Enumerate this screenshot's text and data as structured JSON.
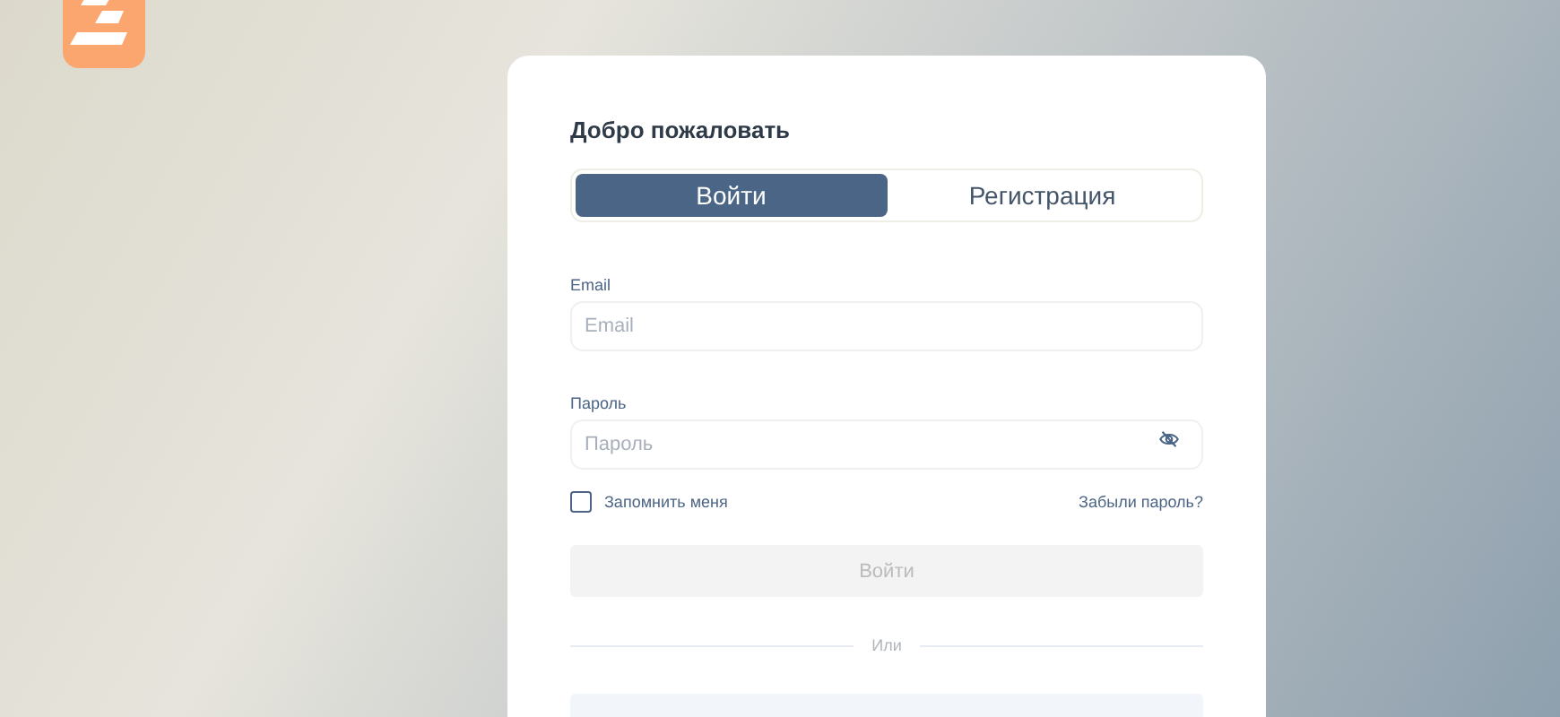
{
  "title": "Добро пожаловать",
  "tabs": [
    {
      "label": "Войти",
      "selected": true
    },
    {
      "label": "Регистрация",
      "selected": false
    }
  ],
  "email": {
    "label": "Email",
    "placeholder": "Email"
  },
  "password": {
    "label": "Пароль",
    "placeholder": "Пароль"
  },
  "remember": {
    "label": "Запомнить меня",
    "checked": false
  },
  "forgot": "Забыли пароль?",
  "submit": {
    "label": "Войти",
    "disabled": true
  },
  "divider": "Или"
}
